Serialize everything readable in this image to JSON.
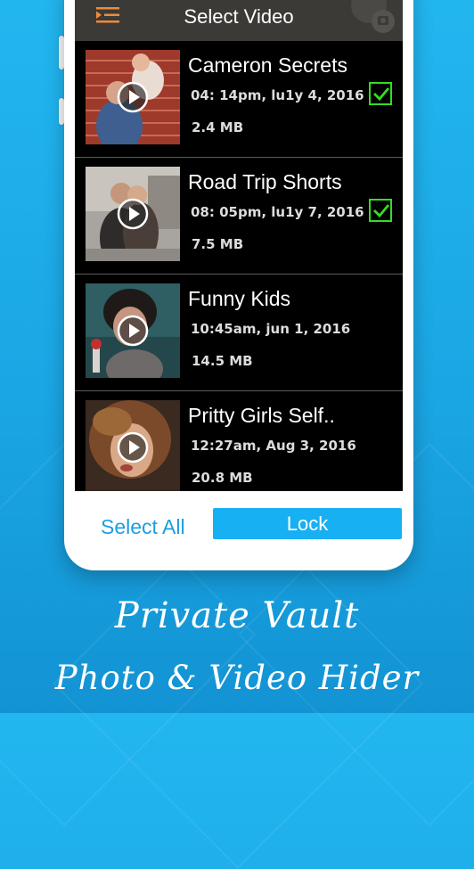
{
  "topbar": {
    "title": "Select Video"
  },
  "videos": [
    {
      "title": "Cameron Secrets",
      "date": "04: 14pm, lu1y 4, 2016",
      "size": "2.4 MB",
      "checked": true
    },
    {
      "title": "Road Trip Shorts",
      "date": "08: 05pm, lu1y 7, 2016",
      "size": "7.5 MB",
      "checked": true
    },
    {
      "title": "Funny Kids",
      "date": "10:45am, jun 1, 2016",
      "size": "14.5 MB",
      "checked": false
    },
    {
      "title": "Pritty Girls Self..",
      "date": "12:27am, Aug 3, 2016",
      "size": "20.8 MB",
      "checked": false
    }
  ],
  "actions": {
    "select_all": "Select All",
    "lock": "Lock"
  },
  "promo": {
    "line1": "Private Vault",
    "line2": "Photo & Video Hider"
  },
  "colors": {
    "accent": "#17b0f2",
    "check": "#33dd22",
    "menu_icon": "#f08a3a"
  },
  "icons": {
    "menu": "menu-icon",
    "play": "play-icon",
    "checkbox": "checkbox-checked-icon"
  }
}
